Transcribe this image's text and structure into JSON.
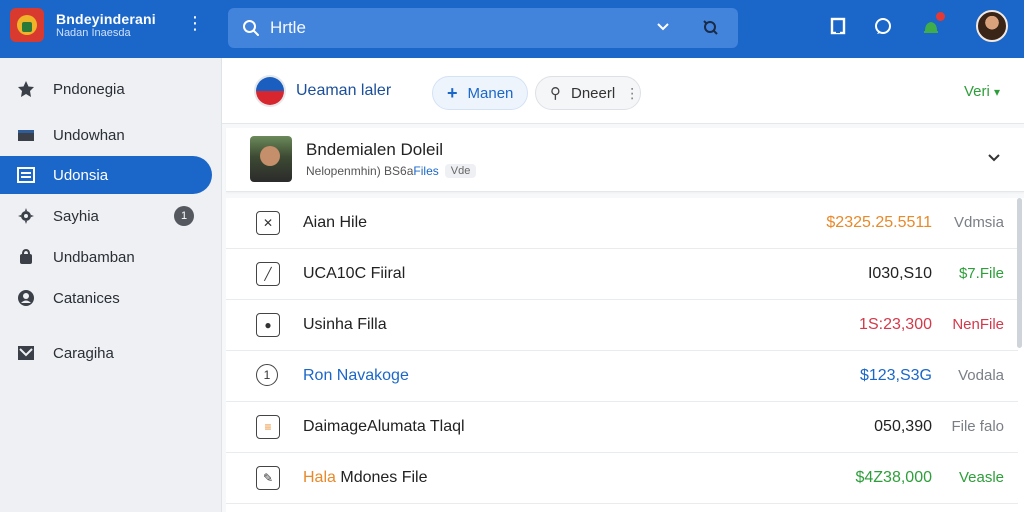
{
  "header": {
    "brand_title": "Bndeyinderani",
    "brand_subtitle": "Nadan Inaesda",
    "search_placeholder": "Hrtle"
  },
  "sidebar": {
    "items": [
      {
        "label": "Pndonegia",
        "icon": "star-icon"
      },
      {
        "label": "Undowhan",
        "icon": "folder-icon"
      },
      {
        "label": "Udonsia",
        "icon": "list-icon",
        "active": true
      },
      {
        "label": "Sayhia",
        "icon": "gear-icon"
      },
      {
        "label": "Undbamban",
        "icon": "bag-icon"
      },
      {
        "label": "Catanices",
        "icon": "person-icon"
      },
      {
        "label": "Caragiha",
        "icon": "image-icon"
      }
    ],
    "badge": "1"
  },
  "toolbar": {
    "title": "Ueaman laler",
    "primary_chip": "Manen",
    "secondary_chip": "Dneerl",
    "view_label": "Veri"
  },
  "info_card": {
    "title": "Bndemialen Doleil",
    "subtitle": "Nelopenmhin) BS6a",
    "subtitle_link": "Files",
    "tag": "Vde"
  },
  "files": [
    {
      "name": "Aian Hile",
      "amount": "$2325.25.5511",
      "status": "Vdmsia",
      "amount_color": "#e8892a",
      "status_color": "#7a7f86",
      "name_color": "#222222",
      "icon": "x-box-icon"
    },
    {
      "name": "UCA10C Fiiral",
      "amount": "I030,S10",
      "status": "$7.File",
      "amount_color": "#222222",
      "status_color": "#2e9e3a",
      "name_color": "#222222",
      "icon": "edit-box-icon"
    },
    {
      "name": "Usinha Filla",
      "amount": "1S:23,300",
      "status": "NenFile",
      "amount_color": "#d23a4b",
      "status_color": "#d23a4b",
      "name_color": "#222222",
      "icon": "file-icon"
    },
    {
      "name": "Ron Navakoge",
      "amount": "$123,S3G",
      "status": "Vodala",
      "amount_color": "#1b67c9",
      "status_color": "#7a7f86",
      "name_color": "#1b67c9",
      "icon": "circle-icon"
    },
    {
      "name": "DaimageAlumata Tlaql",
      "amount": "050,390",
      "status": "File falo",
      "amount_color": "#222222",
      "status_color": "#7a7f86",
      "name_color": "#222222",
      "icon": "note-icon"
    },
    {
      "name": "Mdones File",
      "name_prefix": "Hala",
      "amount": "$4Z38,000",
      "status": "Veasle",
      "amount_color": "#2e9e3a",
      "status_color": "#2e9e3a",
      "name_color": "#222222",
      "icon": "pen-box-icon"
    }
  ],
  "colors": {
    "accent": "#1b67c9",
    "sidebar_bg": "#eef0f3",
    "success": "#2e9e3a",
    "danger": "#d23a4b",
    "warning": "#e8892a"
  }
}
